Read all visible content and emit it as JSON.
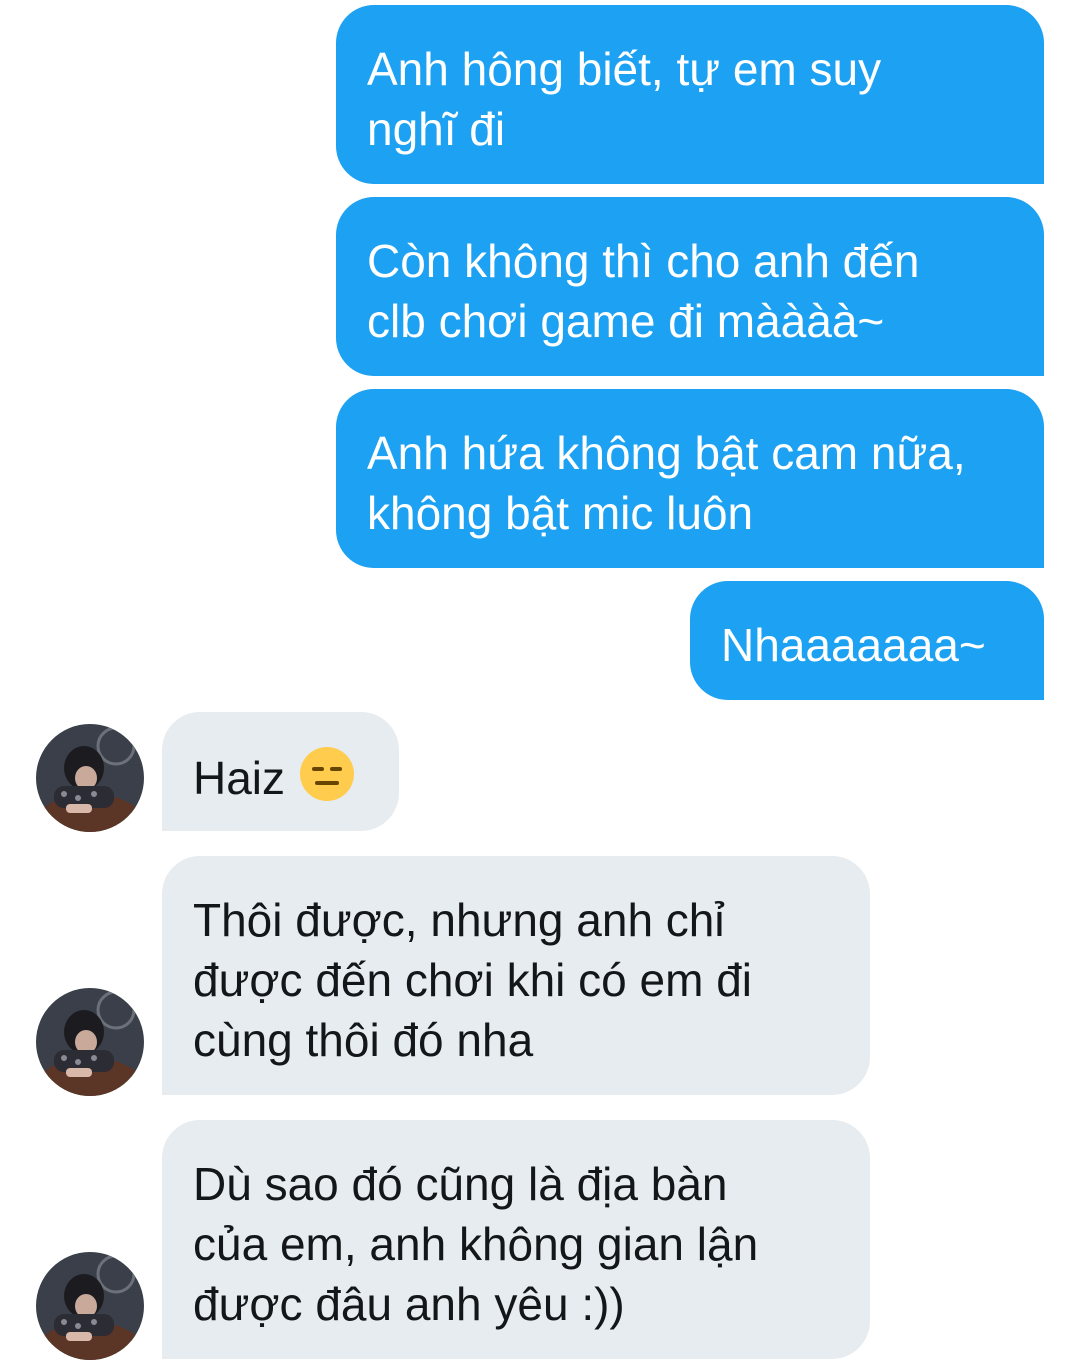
{
  "messages": [
    {
      "id": "s1",
      "direction": "sent",
      "lines": [
        "Anh hông biết, tự em suy",
        "nghĩ đi"
      ]
    },
    {
      "id": "s2",
      "direction": "sent",
      "lines": [
        "Còn không thì cho anh đến",
        "clb chơi game đi màààà~"
      ]
    },
    {
      "id": "s3",
      "direction": "sent",
      "lines": [
        "Anh hứa không bật cam nữa,",
        "không bật mic luôn"
      ]
    },
    {
      "id": "s4",
      "direction": "sent",
      "lines": [
        "Nhaaaaaaa~"
      ]
    },
    {
      "id": "r1",
      "direction": "received",
      "lines": [
        "Haiz"
      ],
      "emoji": "expressionless-face-emoji"
    },
    {
      "id": "r2",
      "direction": "received",
      "lines": [
        "Thôi được, nhưng anh chỉ",
        "được đến chơi khi có em đi",
        "cùng thôi đó nha"
      ]
    },
    {
      "id": "r3",
      "direction": "received",
      "lines": [
        "Dù sao đó cũng là địa bàn",
        "của em, anh không gian lận",
        "được đâu anh yêu :))"
      ]
    }
  ],
  "colors": {
    "sent_bubble": "#1da1f2",
    "sent_text": "#ffffff",
    "received_bubble": "#e6ecf0",
    "received_text": "#14171a"
  }
}
